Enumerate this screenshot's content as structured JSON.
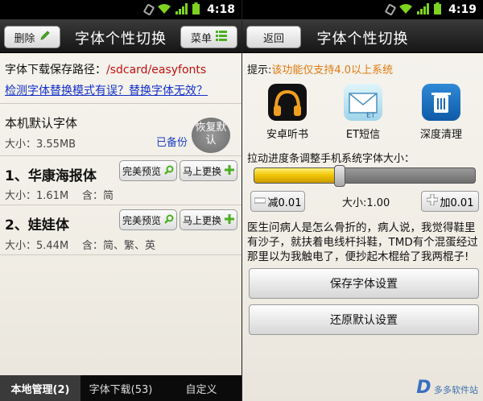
{
  "left": {
    "status": {
      "time": "4:18"
    },
    "title": "字体个性切换",
    "delete_label": "删除",
    "menu_label": "菜单",
    "save_path_label": "字体下载保存路径：",
    "save_path_value": "/sdcard/easyfonts",
    "help_link": "检测字体替换模式有误？替换字体无效？",
    "default_font": {
      "name": "本机默认字体",
      "size": "大小：3.55MB",
      "restore_label": "恢复默认",
      "backed_up": "已备份"
    },
    "fonts": [
      {
        "name": "1、华康海报体",
        "size": "大小：1.61M",
        "contains": "含：简",
        "preview": "完美预览",
        "replace": "马上更换"
      },
      {
        "name": "2、娃娃体",
        "size": "大小：5.44M",
        "contains": "含：简、繁、英",
        "preview": "完美预览",
        "replace": "马上更换"
      }
    ],
    "tabs": [
      "本地管理(2)",
      "字体下载(53)",
      "自定义"
    ]
  },
  "right": {
    "status": {
      "time": "4:19"
    },
    "title": "字体个性切换",
    "back_label": "返回",
    "tip_label": "提示:",
    "tip_value": "该功能仅支持4.0以上系统",
    "apps": [
      {
        "name": "安卓听书",
        "icon": "headphones-icon"
      },
      {
        "name": "ET短信",
        "icon": "envelope-icon"
      },
      {
        "name": "深度清理",
        "icon": "trash-icon"
      }
    ],
    "slider_label": "拉动进度条调整手机系统字体大小：",
    "slider_level": 0.37,
    "minus_label": "减0.01",
    "size_label": "大小:1.00",
    "plus_label": "加0.01",
    "sample_text": "医生问病人是怎么骨折的，病人说，我觉得鞋里有沙子，就扶着电线杆抖鞋，TMD有个混蛋经过那里以为我触电了，便抄起木棍给了我两棍子!",
    "save_button": "保存字体设置",
    "restore_button": "还原默认设置",
    "watermark": "多多软件站"
  },
  "colors": {
    "accent_red": "#c01010",
    "link_blue": "#1530c8",
    "slider_yellow": "#f0c400"
  }
}
